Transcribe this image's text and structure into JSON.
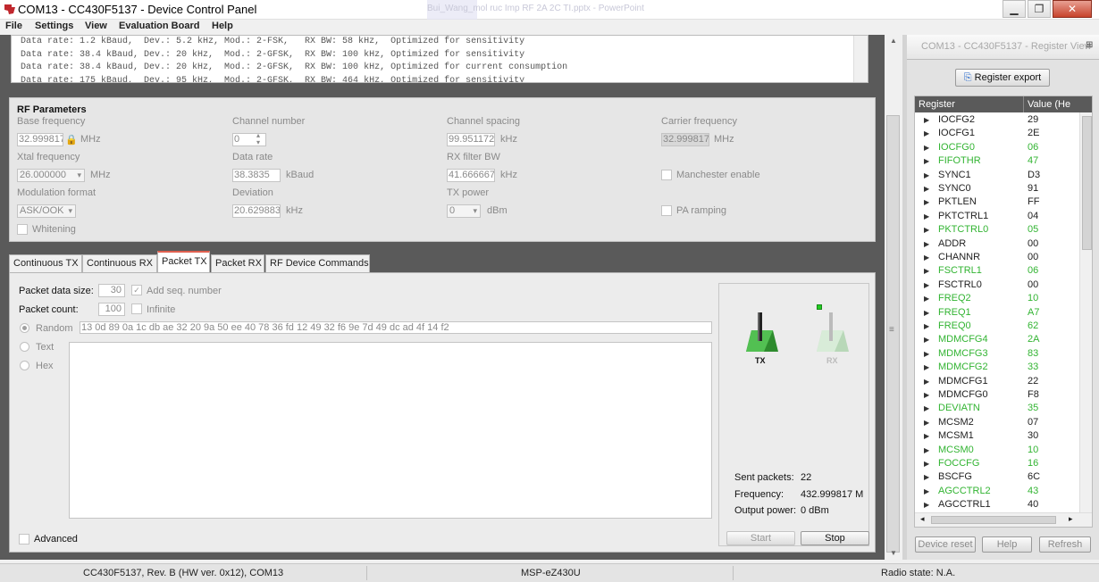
{
  "window": {
    "title": "COM13 - CC430F5137 - Device Control Panel",
    "background_title": "Bui_Wang_mol ruc Imp RF 2A 2C TI.pptx - PowerPoint"
  },
  "menu": [
    "File",
    "Settings",
    "View",
    "Evaluation Board",
    "Help"
  ],
  "log_lines": [
    "Data rate: 1.2 kBaud,  Dev.: 5.2 kHz, Mod.: 2-FSK,   RX BW: 58 kHz,  Optimized for sensitivity",
    "Data rate: 38.4 kBaud, Dev.: 20 kHz,  Mod.: 2-GFSK,  RX BW: 100 kHz, Optimized for sensitivity",
    "Data rate: 38.4 kBaud, Dev.: 20 kHz,  Mod.: 2-GFSK,  RX BW: 100 kHz, Optimized for current consumption",
    "Data rate: 175 kBaud,  Dev.: 95 kHz,  Mod.: 2-GFSK,  RX BW: 464 kHz, Optimized for sensitivity"
  ],
  "rf": {
    "title": "RF Parameters",
    "base_freq": {
      "label": "Base frequency",
      "value": "32.999817",
      "unit": "MHz"
    },
    "channel_number": {
      "label": "Channel number",
      "value": "0"
    },
    "channel_spacing": {
      "label": "Channel spacing",
      "value": "99.951172",
      "unit": "kHz"
    },
    "carrier_freq": {
      "label": "Carrier frequency",
      "value": "32.999817",
      "unit": "MHz"
    },
    "xtal_freq": {
      "label": "Xtal frequency",
      "value": "26.000000",
      "unit": "MHz"
    },
    "data_rate": {
      "label": "Data rate",
      "value": "38.3835",
      "unit": "kBaud"
    },
    "rx_filter_bw": {
      "label": "RX filter BW",
      "value": "41.666667",
      "unit": "kHz"
    },
    "manchester": {
      "label": "Manchester enable"
    },
    "modulation": {
      "label": "Modulation format",
      "value": "ASK/OOK"
    },
    "deviation": {
      "label": "Deviation",
      "value": "20.629883",
      "unit": "kHz"
    },
    "tx_power": {
      "label": "TX power",
      "value": "0",
      "unit": "dBm"
    },
    "pa_ramping": {
      "label": "PA ramping"
    },
    "whitening": {
      "label": "Whitening"
    }
  },
  "tabs": [
    "Continuous TX",
    "Continuous RX",
    "Packet TX",
    "Packet RX",
    "RF Device Commands"
  ],
  "packet_tx": {
    "size_label": "Packet data size:",
    "size_value": "30",
    "add_seq_label": "Add seq. number",
    "count_label": "Packet count:",
    "count_value": "100",
    "infinite_label": "Infinite",
    "random_label": "Random",
    "random_data": "13 0d 89 0a 1c db ae 32 20 9a 50 ee 40 78 36 fd 12 49 32 f6 9e 7d 49 dc ad 4f 14 f2",
    "text_label": "Text",
    "hex_label": "Hex",
    "advanced_label": "Advanced",
    "tx_label": "TX",
    "rx_label": "RX",
    "sent_label": "Sent packets:",
    "sent_value": "22",
    "freq_label": "Frequency:",
    "freq_value": "432.999817 M",
    "power_label": "Output power:",
    "power_value": "0 dBm",
    "start_label": "Start",
    "stop_label": "Stop"
  },
  "register_view": {
    "title": "COM13 - CC430F5137 - Register View",
    "export_label": "Register export",
    "col_register": "Register",
    "col_value": "Value (He",
    "rows": [
      {
        "name": "IOCFG2",
        "value": "29",
        "changed": false
      },
      {
        "name": "IOCFG1",
        "value": "2E",
        "changed": false
      },
      {
        "name": "IOCFG0",
        "value": "06",
        "changed": true
      },
      {
        "name": "FIFOTHR",
        "value": "47",
        "changed": true
      },
      {
        "name": "SYNC1",
        "value": "D3",
        "changed": false
      },
      {
        "name": "SYNC0",
        "value": "91",
        "changed": false
      },
      {
        "name": "PKTLEN",
        "value": "FF",
        "changed": false
      },
      {
        "name": "PKTCTRL1",
        "value": "04",
        "changed": false
      },
      {
        "name": "PKTCTRL0",
        "value": "05",
        "changed": true
      },
      {
        "name": "ADDR",
        "value": "00",
        "changed": false
      },
      {
        "name": "CHANNR",
        "value": "00",
        "changed": false
      },
      {
        "name": "FSCTRL1",
        "value": "06",
        "changed": true
      },
      {
        "name": "FSCTRL0",
        "value": "00",
        "changed": false
      },
      {
        "name": "FREQ2",
        "value": "10",
        "changed": true
      },
      {
        "name": "FREQ1",
        "value": "A7",
        "changed": true
      },
      {
        "name": "FREQ0",
        "value": "62",
        "changed": true
      },
      {
        "name": "MDMCFG4",
        "value": "2A",
        "changed": true
      },
      {
        "name": "MDMCFG3",
        "value": "83",
        "changed": true
      },
      {
        "name": "MDMCFG2",
        "value": "33",
        "changed": true
      },
      {
        "name": "MDMCFG1",
        "value": "22",
        "changed": false
      },
      {
        "name": "MDMCFG0",
        "value": "F8",
        "changed": false
      },
      {
        "name": "DEVIATN",
        "value": "35",
        "changed": true
      },
      {
        "name": "MCSM2",
        "value": "07",
        "changed": false
      },
      {
        "name": "MCSM1",
        "value": "30",
        "changed": false
      },
      {
        "name": "MCSM0",
        "value": "10",
        "changed": true
      },
      {
        "name": "FOCCFG",
        "value": "16",
        "changed": true
      },
      {
        "name": "BSCFG",
        "value": "6C",
        "changed": false
      },
      {
        "name": "AGCCTRL2",
        "value": "43",
        "changed": true
      },
      {
        "name": "AGCCTRL1",
        "value": "40",
        "changed": false
      }
    ],
    "device_reset_label": "Device reset",
    "help_label": "Help",
    "refresh_label": "Refresh"
  },
  "status": {
    "device": "CC430F5137, Rev. B (HW ver. 0x12), COM13",
    "debugger": "MSP-eZ430U",
    "radio": "Radio state: N.A."
  },
  "colors": {
    "changed_register": "#32b432",
    "active_tab_accent": "#e06050"
  }
}
